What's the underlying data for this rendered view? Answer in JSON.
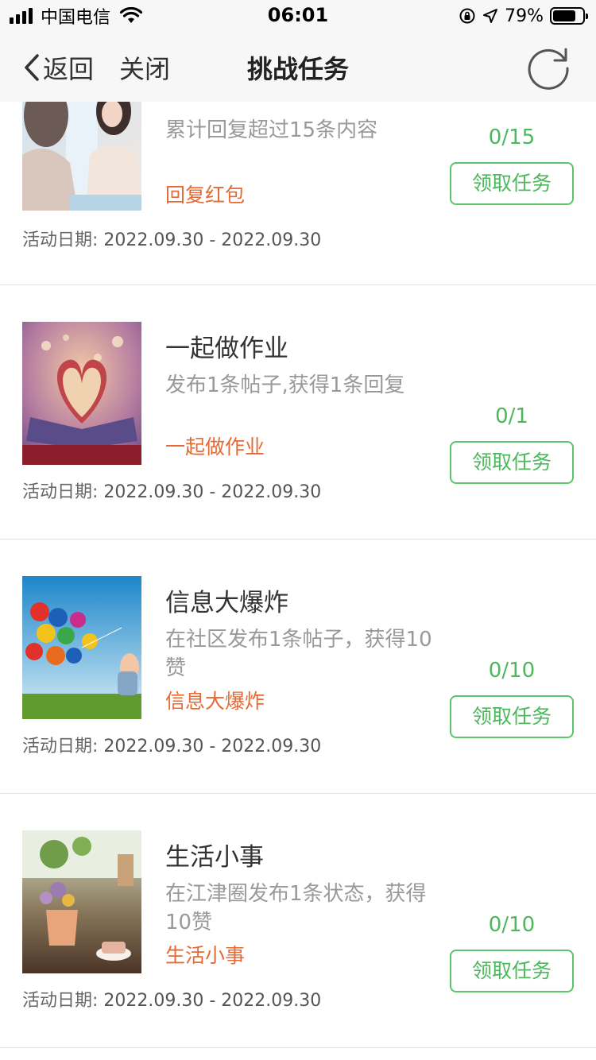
{
  "status_bar": {
    "carrier": "中国电信",
    "time": "06:01",
    "battery": "79%",
    "battery_level": 0.79
  },
  "nav": {
    "back_label": "返回",
    "close_label": "关闭",
    "title": "挑战任务"
  },
  "date_label": "活动日期:",
  "button_label": "领取任务",
  "tasks": [
    {
      "title": "",
      "desc": "累计回复超过15条内容",
      "reward": "回复红包",
      "progress": "0/15",
      "date": "2022.09.30 - 2022.09.30",
      "image": "women-chatting-photo"
    },
    {
      "title": "一起做作业",
      "desc": "发布1条帖子,获得1条回复",
      "reward": "一起做作业",
      "progress": "0/1",
      "date": "2022.09.30 - 2022.09.30",
      "image": "book-heart-photo"
    },
    {
      "title": "信息大爆炸",
      "desc": "在社区发布1条帖子，获得10赞",
      "reward": "信息大爆炸",
      "progress": "0/10",
      "date": "2022.09.30 - 2022.09.30",
      "image": "balloons-photo"
    },
    {
      "title": "生活小事",
      "desc": "在江津圈发布1条状态，获得10赞",
      "reward": "生活小事",
      "progress": "0/10",
      "date": "2022.09.30 - 2022.09.30",
      "image": "flowers-teacup-photo"
    }
  ]
}
